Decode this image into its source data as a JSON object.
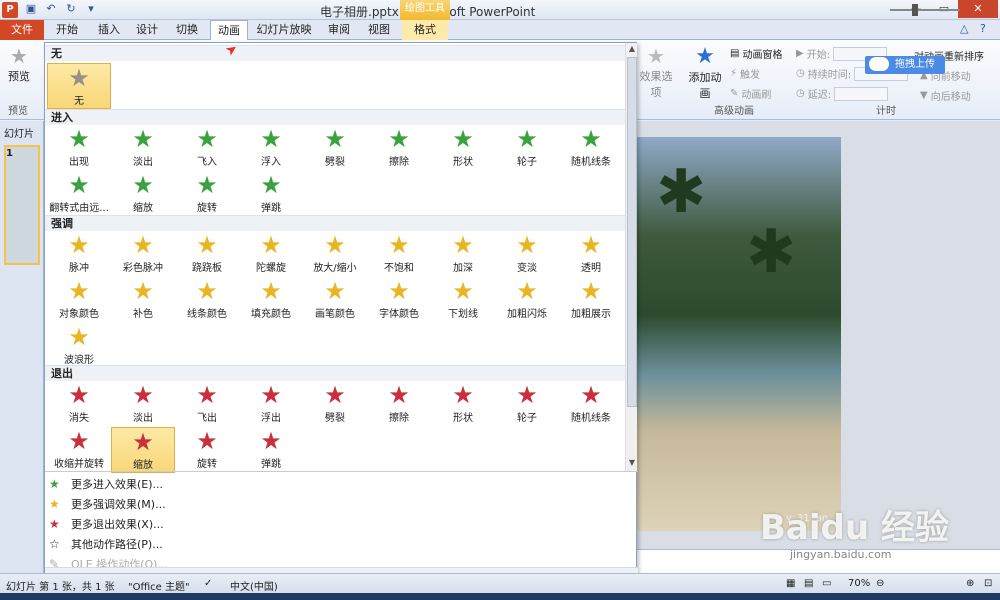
{
  "window": {
    "title": "电子相册.pptx - Microsoft PowerPoint",
    "context_tab": "绘图工具"
  },
  "tabs": [
    {
      "label": "文件"
    },
    {
      "label": "开始"
    },
    {
      "label": "插入"
    },
    {
      "label": "设计"
    },
    {
      "label": "切换"
    },
    {
      "label": "动画"
    },
    {
      "label": "幻灯片放映"
    },
    {
      "label": "审阅"
    },
    {
      "label": "视图"
    },
    {
      "label": "格式"
    }
  ],
  "ribbon": {
    "preview": "预览",
    "preview_group": "预览",
    "effect_options": "效果选项",
    "add_animation": "添加动画",
    "animation_pane": "动画窗格",
    "trigger": "触发",
    "animation_painter": "动画刷",
    "advanced_group": "高级动画",
    "start_label": "开始:",
    "duration_label": "持续时间:",
    "delay_label": "延迟:",
    "reorder": "对动画重新排序",
    "move_earlier": "向前移动",
    "move_later": "向后移动",
    "timing_group": "计时",
    "upload_tip": "拖拽上传"
  },
  "left_pane": {
    "label": "幻灯片",
    "slide_number": "1"
  },
  "gallery": {
    "none_section": "无",
    "none_item": "无",
    "entrance_section": "进入",
    "entrance_items": [
      "出现",
      "淡出",
      "飞入",
      "浮入",
      "劈裂",
      "擦除",
      "形状",
      "轮子",
      "随机线条",
      "翻转式由远...",
      "缩放",
      "旋转",
      "弹跳"
    ],
    "emphasis_section": "强调",
    "emphasis_items": [
      "脉冲",
      "彩色脉冲",
      "跷跷板",
      "陀螺旋",
      "放大/缩小",
      "不饱和",
      "加深",
      "变淡",
      "透明",
      "对象颜色",
      "补色",
      "线条颜色",
      "填充颜色",
      "画笔颜色",
      "字体颜色",
      "下划线",
      "加粗闪烁",
      "加粗展示",
      "波浪形"
    ],
    "exit_section": "退出",
    "exit_items": [
      "消失",
      "淡出",
      "飞出",
      "浮出",
      "劈裂",
      "擦除",
      "形状",
      "轮子",
      "随机线条",
      "收缩并旋转",
      "缩放",
      "旋转",
      "弹跳"
    ],
    "more_entrance": "更多进入效果(E)...",
    "more_emphasis": "更多强调效果(M)...",
    "more_exit": "更多退出效果(X)...",
    "other_paths": "其他动作路径(P)...",
    "ole_verbs": "OLE 操作动作(O)..."
  },
  "status": {
    "slide_info": "幻灯片 第 1 张，共 1 张",
    "theme": "\"Office 主题\"",
    "language": "中文(中国)",
    "zoom": "70%"
  },
  "watermark": {
    "brand": "Baidu 经验",
    "url": "jingyan.baidu.com",
    "slide_text": "y. 31 Jan"
  },
  "colors": {
    "file_tab": "#d24726",
    "selected_item": "#f8d777",
    "context_tab": "#f2b82f"
  }
}
